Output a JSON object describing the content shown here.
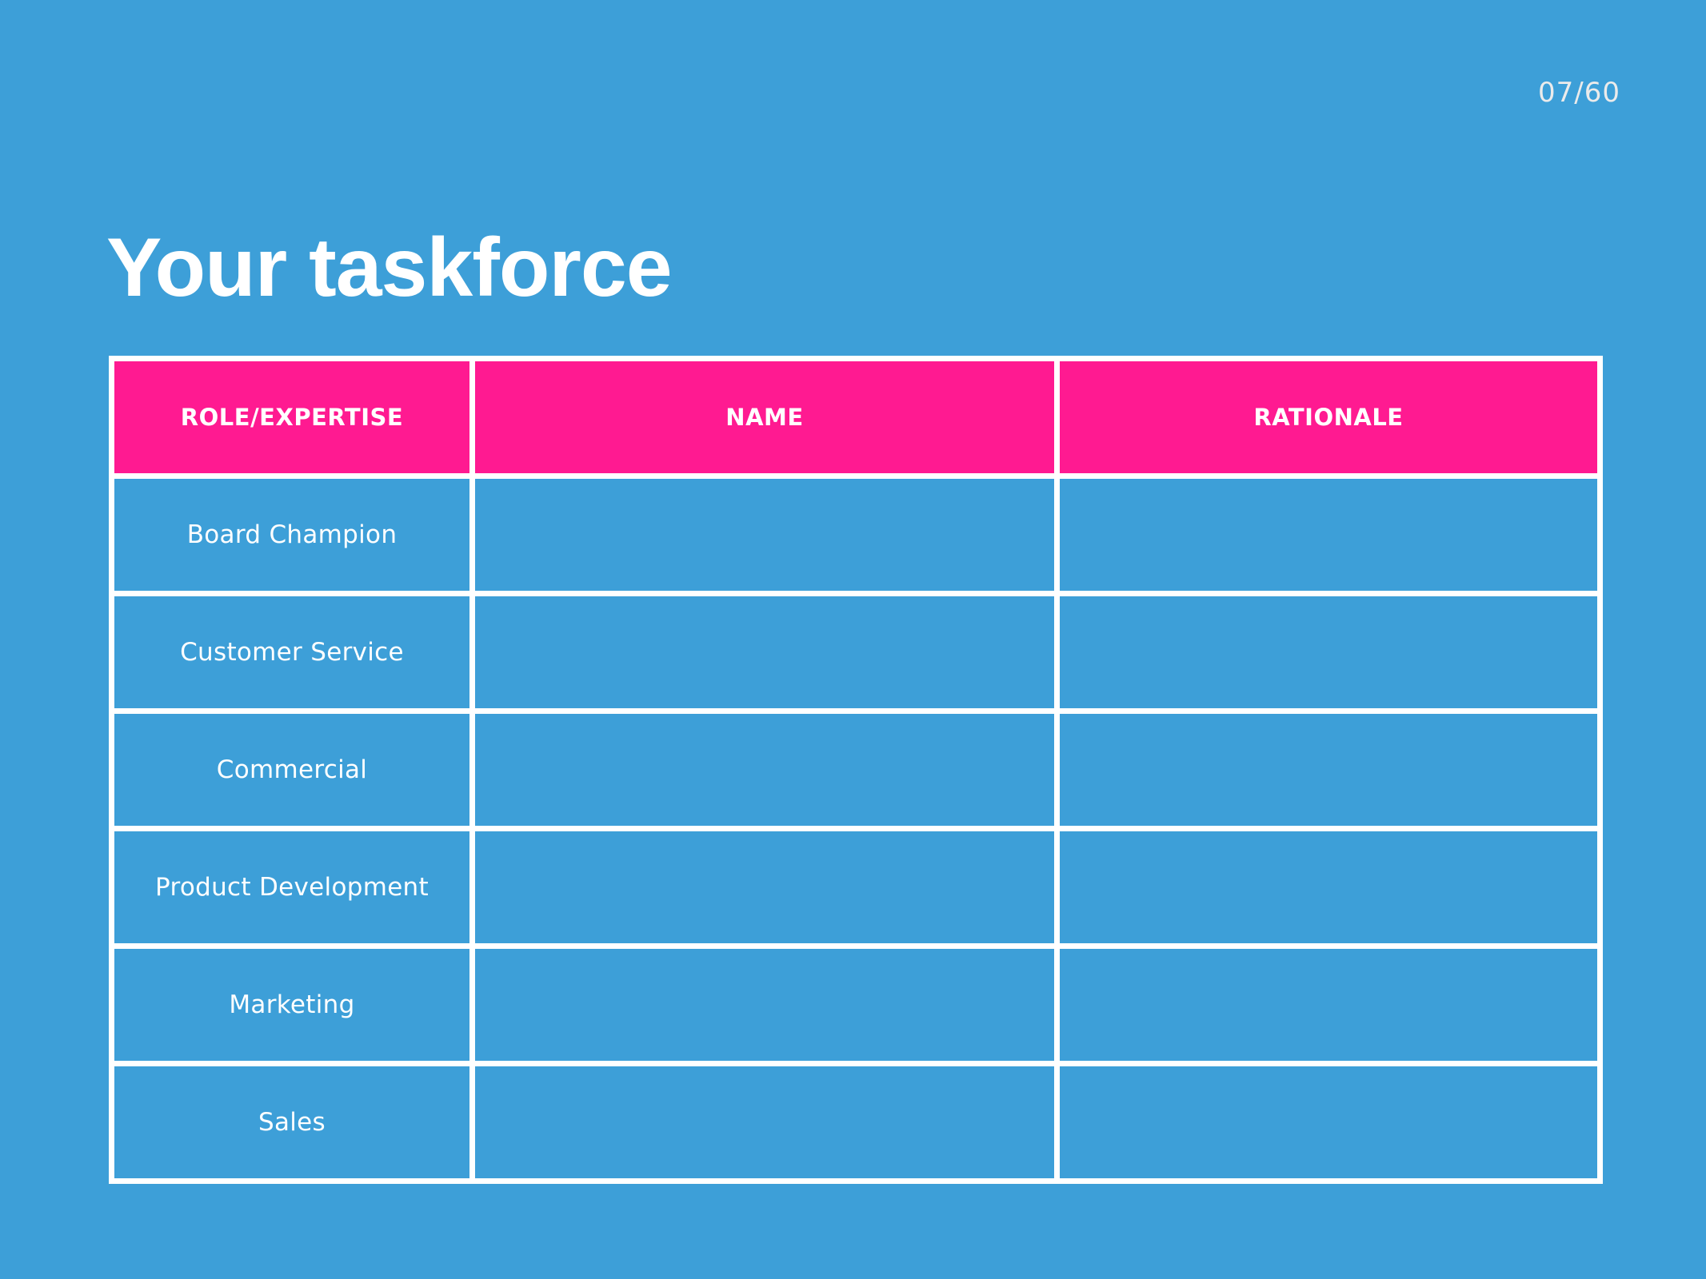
{
  "slide": {
    "page_indicator": "07/60",
    "title": "Your taskforce"
  },
  "colors": {
    "background": "#3d9fd8",
    "header_fill": "#ff1a91",
    "grid_lines": "#ffffff",
    "page_indicator_text": "#ebebeb"
  },
  "table": {
    "headers": [
      "ROLE/EXPERTISE",
      "NAME",
      "RATIONALE"
    ],
    "rows": [
      {
        "role": "Board Champion",
        "name": "",
        "rationale": ""
      },
      {
        "role": "Customer Service",
        "name": "",
        "rationale": ""
      },
      {
        "role": "Commercial",
        "name": "",
        "rationale": ""
      },
      {
        "role": "Product Development",
        "name": "",
        "rationale": ""
      },
      {
        "role": "Marketing",
        "name": "",
        "rationale": ""
      },
      {
        "role": "Sales",
        "name": "",
        "rationale": ""
      }
    ]
  }
}
